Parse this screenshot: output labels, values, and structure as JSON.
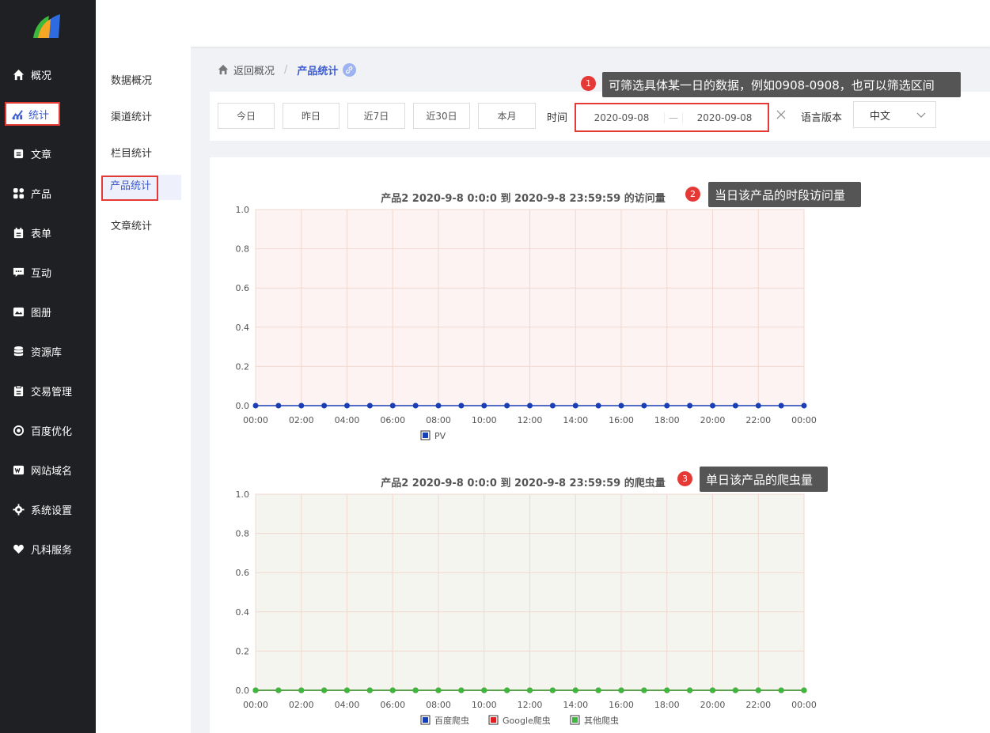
{
  "sidebar": {
    "items": [
      {
        "label": "概况",
        "icon": "home-icon"
      },
      {
        "label": "统计",
        "icon": "stats-icon"
      },
      {
        "label": "文章",
        "icon": "article-icon"
      },
      {
        "label": "产品",
        "icon": "product-icon"
      },
      {
        "label": "表单",
        "icon": "form-icon"
      },
      {
        "label": "互动",
        "icon": "chat-icon"
      },
      {
        "label": "图册",
        "icon": "album-icon"
      },
      {
        "label": "资源库",
        "icon": "database-icon"
      },
      {
        "label": "交易管理",
        "icon": "clipboard-icon"
      },
      {
        "label": "百度优化",
        "icon": "seo-icon"
      },
      {
        "label": "网站域名",
        "icon": "website-icon"
      },
      {
        "label": "系统设置",
        "icon": "gear-icon"
      },
      {
        "label": "凡科服务",
        "icon": "heart-icon"
      }
    ]
  },
  "submenu": {
    "items": [
      "数据概况",
      "渠道统计",
      "栏目统计",
      "产品统计",
      "文章统计"
    ]
  },
  "breadcrumb": {
    "back": "返回概况",
    "separator": "/",
    "current": "产品统计"
  },
  "filter": {
    "quick": [
      "今日",
      "昨日",
      "近7日",
      "近30日",
      "本月"
    ],
    "time_label": "时间",
    "start_date": "2020-09-08",
    "range_sep": "—",
    "end_date": "2020-09-08",
    "lang_label": "语言版本",
    "lang_value": "中文"
  },
  "annotations": [
    {
      "num": "1",
      "text": "可筛选具体某一日的数据，例如0908-0908，也可以筛选区间"
    },
    {
      "num": "2",
      "text": "当日该产品的时段访问量"
    },
    {
      "num": "3",
      "text": "单日该产品的爬虫量"
    }
  ],
  "colors": {
    "accent": "#3c5bd3",
    "highlight": "#e53935",
    "sidebar_bg": "#1f2024",
    "chart1_bg": "#fdf3f2",
    "chart2_bg": "#f5f5f0",
    "grid": "#f0d8d0"
  },
  "chart_data": [
    {
      "type": "line",
      "title": "产品2 2020-9-8 0:0:0 到 2020-9-8 23:59:59 的访问量",
      "x_ticks": [
        "00:00",
        "02:00",
        "04:00",
        "06:00",
        "08:00",
        "10:00",
        "12:00",
        "14:00",
        "16:00",
        "18:00",
        "20:00",
        "22:00",
        "00:00"
      ],
      "y_ticks": [
        "0.0",
        "0.2",
        "0.4",
        "0.6",
        "0.8",
        "1.0"
      ],
      "ylim": [
        0,
        1
      ],
      "grid": true,
      "legend": "bottom",
      "series": [
        {
          "name": "PV",
          "color": "#1a3fb5",
          "values": [
            0,
            0,
            0,
            0,
            0,
            0,
            0,
            0,
            0,
            0,
            0,
            0,
            0,
            0,
            0,
            0,
            0,
            0,
            0,
            0,
            0,
            0,
            0,
            0,
            0
          ]
        }
      ]
    },
    {
      "type": "line",
      "title": "产品2 2020-9-8 0:0:0 到 2020-9-8 23:59:59 的爬虫量",
      "x_ticks": [
        "00:00",
        "02:00",
        "04:00",
        "06:00",
        "08:00",
        "10:00",
        "12:00",
        "14:00",
        "16:00",
        "18:00",
        "20:00",
        "22:00",
        "00:00"
      ],
      "y_ticks": [
        "0.0",
        "0.2",
        "0.4",
        "0.6",
        "0.8",
        "1.0"
      ],
      "ylim": [
        0,
        1
      ],
      "grid": true,
      "legend": "bottom",
      "series": [
        {
          "name": "百度爬虫",
          "color": "#1a3fb5",
          "values": [
            0,
            0,
            0,
            0,
            0,
            0,
            0,
            0,
            0,
            0,
            0,
            0,
            0,
            0,
            0,
            0,
            0,
            0,
            0,
            0,
            0,
            0,
            0,
            0,
            0
          ]
        },
        {
          "name": "Google爬虫",
          "color": "#e02020",
          "values": [
            0,
            0,
            0,
            0,
            0,
            0,
            0,
            0,
            0,
            0,
            0,
            0,
            0,
            0,
            0,
            0,
            0,
            0,
            0,
            0,
            0,
            0,
            0,
            0,
            0
          ]
        },
        {
          "name": "其他爬虫",
          "color": "#3cb83c",
          "values": [
            0,
            0,
            0,
            0,
            0,
            0,
            0,
            0,
            0,
            0,
            0,
            0,
            0,
            0,
            0,
            0,
            0,
            0,
            0,
            0,
            0,
            0,
            0,
            0,
            0
          ]
        }
      ]
    }
  ]
}
